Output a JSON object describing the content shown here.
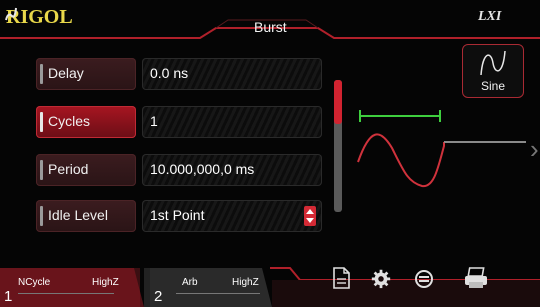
{
  "header": {
    "logo": "RIGOL",
    "title": "Burst",
    "status_label": "LXI"
  },
  "params": [
    {
      "label": "Delay",
      "value": "0.0 ns",
      "active": false
    },
    {
      "label": "Cycles",
      "value": "1",
      "active": true
    },
    {
      "label": "Period",
      "value": "10.000,000,0 ms",
      "active": false
    },
    {
      "label": "Idle Level",
      "value": "1st Point",
      "active": false
    }
  ],
  "waveform_button": {
    "label": "Sine",
    "icon": "sine-wave-icon"
  },
  "channels": [
    {
      "number": "1",
      "mode": "NCycle",
      "impedance": "HighZ",
      "active": true
    },
    {
      "number": "2",
      "mode": "Arb",
      "impedance": "HighZ",
      "active": false
    }
  ],
  "bottom_icons": [
    "document-icon",
    "gear-icon",
    "sync-icon",
    "printer-icon"
  ],
  "colors": {
    "accent": "#c8202c",
    "logo": "#e9d84a",
    "marker": "#3ecf3e"
  }
}
